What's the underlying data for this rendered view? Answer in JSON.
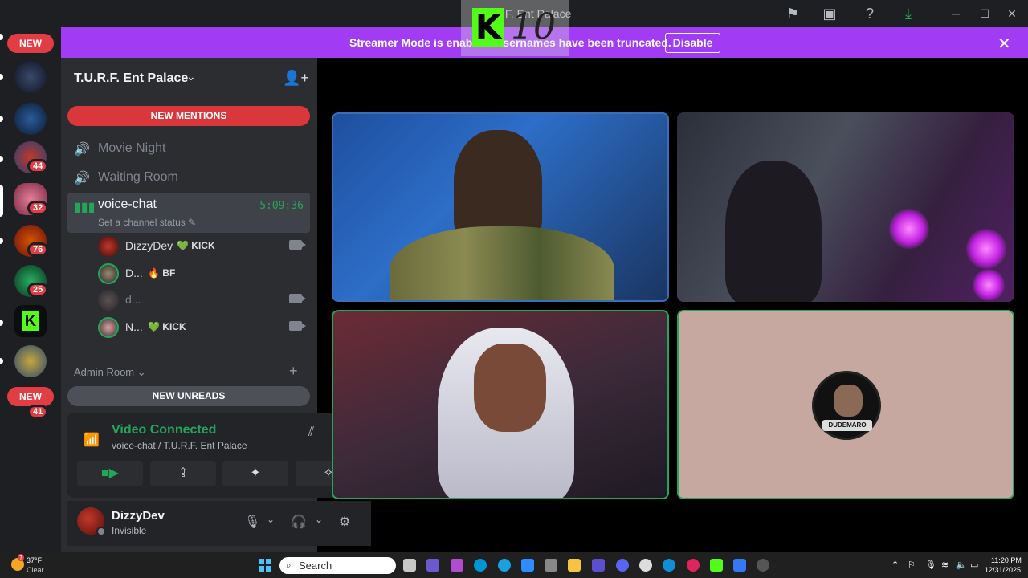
{
  "window": {
    "title": "T.U.R.F. Ent Palace",
    "kick_count": "10"
  },
  "banner": {
    "message": "Streamer Mode is enabled. Usernames have been truncated.",
    "disable_label": "Disable",
    "close_icon": "close-icon"
  },
  "rail": {
    "new_label": "NEW",
    "badges": [
      "44",
      "32",
      "76",
      "25",
      "41"
    ],
    "bottom_new_label": "NEW"
  },
  "server": {
    "name": "T.U.R.F. Ent Palace",
    "new_mentions": "NEW MENTIONS",
    "new_unreads": "NEW UNREADS",
    "channels": [
      {
        "name": "Movie Night",
        "icon": "speaker-icon"
      },
      {
        "name": "Waiting Room",
        "icon": "speaker-icon"
      }
    ],
    "voice_channel": {
      "name": "voice-chat",
      "status_placeholder": "Set a channel status",
      "timer": "5:09:36"
    },
    "members": [
      {
        "name": "DizzyDev",
        "tag": "💚 KICK",
        "camera": true
      },
      {
        "name": "D...",
        "tag": "🔥 BF",
        "camera": false
      },
      {
        "name": "d...",
        "tag": "",
        "camera": true
      },
      {
        "name": "N...",
        "tag": "💚 KICK",
        "camera": true
      }
    ],
    "category": "Admin Room"
  },
  "voice_panel": {
    "state": "Video Connected",
    "location": "voice-chat / T.U.R.F. Ent Palace"
  },
  "user": {
    "name": "DizzyDev",
    "status": "Invisible"
  },
  "tiles": {
    "avatar_label": "DUDEMARO"
  },
  "taskbar": {
    "weather_temp": "37°F",
    "weather_cond": "Clear",
    "weather_alert": "7",
    "search_placeholder": "Search",
    "time": "11:20 PM",
    "date": "12/31/2025"
  },
  "colors": {
    "accent_green": "#23a55a",
    "banner_purple": "#a23cf4",
    "mention_red": "#da373c",
    "kick_green": "#53fc18"
  }
}
